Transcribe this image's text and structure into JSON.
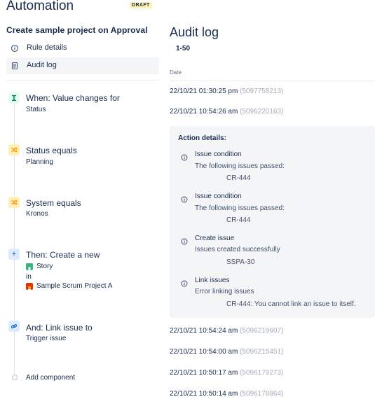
{
  "app": {
    "title": "Automation",
    "status_badge": "DRAFT"
  },
  "rule": {
    "name": "Create sample project on Approval"
  },
  "nav": {
    "items": [
      {
        "label": "Rule details",
        "icon": "info-icon",
        "selected": false
      },
      {
        "label": "Audit log",
        "icon": "document-icon",
        "selected": true
      }
    ]
  },
  "components": [
    {
      "kind": "trigger",
      "icon": "value-change-trigger-icon",
      "title": "When: Value changes for",
      "subtitle": "Status"
    },
    {
      "kind": "condition",
      "icon": "shuffle-icon",
      "title": "Status equals",
      "subtitle": "Planning"
    },
    {
      "kind": "condition",
      "icon": "shuffle-icon",
      "title": "System equals",
      "subtitle": "Kronos"
    },
    {
      "kind": "action",
      "icon": "plus-icon",
      "title": "Then: Create a new",
      "issue_type": "Story",
      "joiner": "in",
      "project": "Sample Scrum Project A"
    },
    {
      "kind": "action",
      "icon": "link-icon",
      "title": "And: Link issue to",
      "subtitle": "Trigger issue"
    }
  ],
  "add_component": "Add component",
  "audit": {
    "title": "Audit log",
    "range": "1-50",
    "column_date": "Date",
    "entries": [
      {
        "date": "22/10/21 01:30:25 pm",
        "id": "(5097758213)"
      },
      {
        "date": "22/10/21 10:54:26 am",
        "id": "(5096220163)"
      },
      {
        "date": "22/10/21 10:54:24 am",
        "id": "(5096219607)"
      },
      {
        "date": "22/10/21 10:54:00 am",
        "id": "(5096215451)"
      },
      {
        "date": "22/10/21 10:50:17 am",
        "id": "(5096179273)"
      },
      {
        "date": "22/10/21 10:50:14 am",
        "id": "(5096178864)"
      }
    ],
    "details": {
      "title": "Action details:",
      "actions": [
        {
          "title": "Issue condition",
          "desc": "The following issues passed:",
          "value": "CR-444"
        },
        {
          "title": "Issue condition",
          "desc": "The following issues passed:",
          "value": "CR-444"
        },
        {
          "title": "Create issue",
          "desc": "Issues created successfully",
          "value": "SSPA-30"
        },
        {
          "title": "Link issues",
          "desc": "Error linking issues",
          "value": "CR-444: You cannot link an issue to itself."
        }
      ]
    }
  },
  "colors": {
    "trigger": "#e3fcef",
    "trigger_fg": "#00875a",
    "condition": "#fff0b3",
    "condition_fg": "#ff8b00",
    "action": "#deebff",
    "action_fg": "#0052cc",
    "story": "#36b37e",
    "project": "#de350b"
  }
}
